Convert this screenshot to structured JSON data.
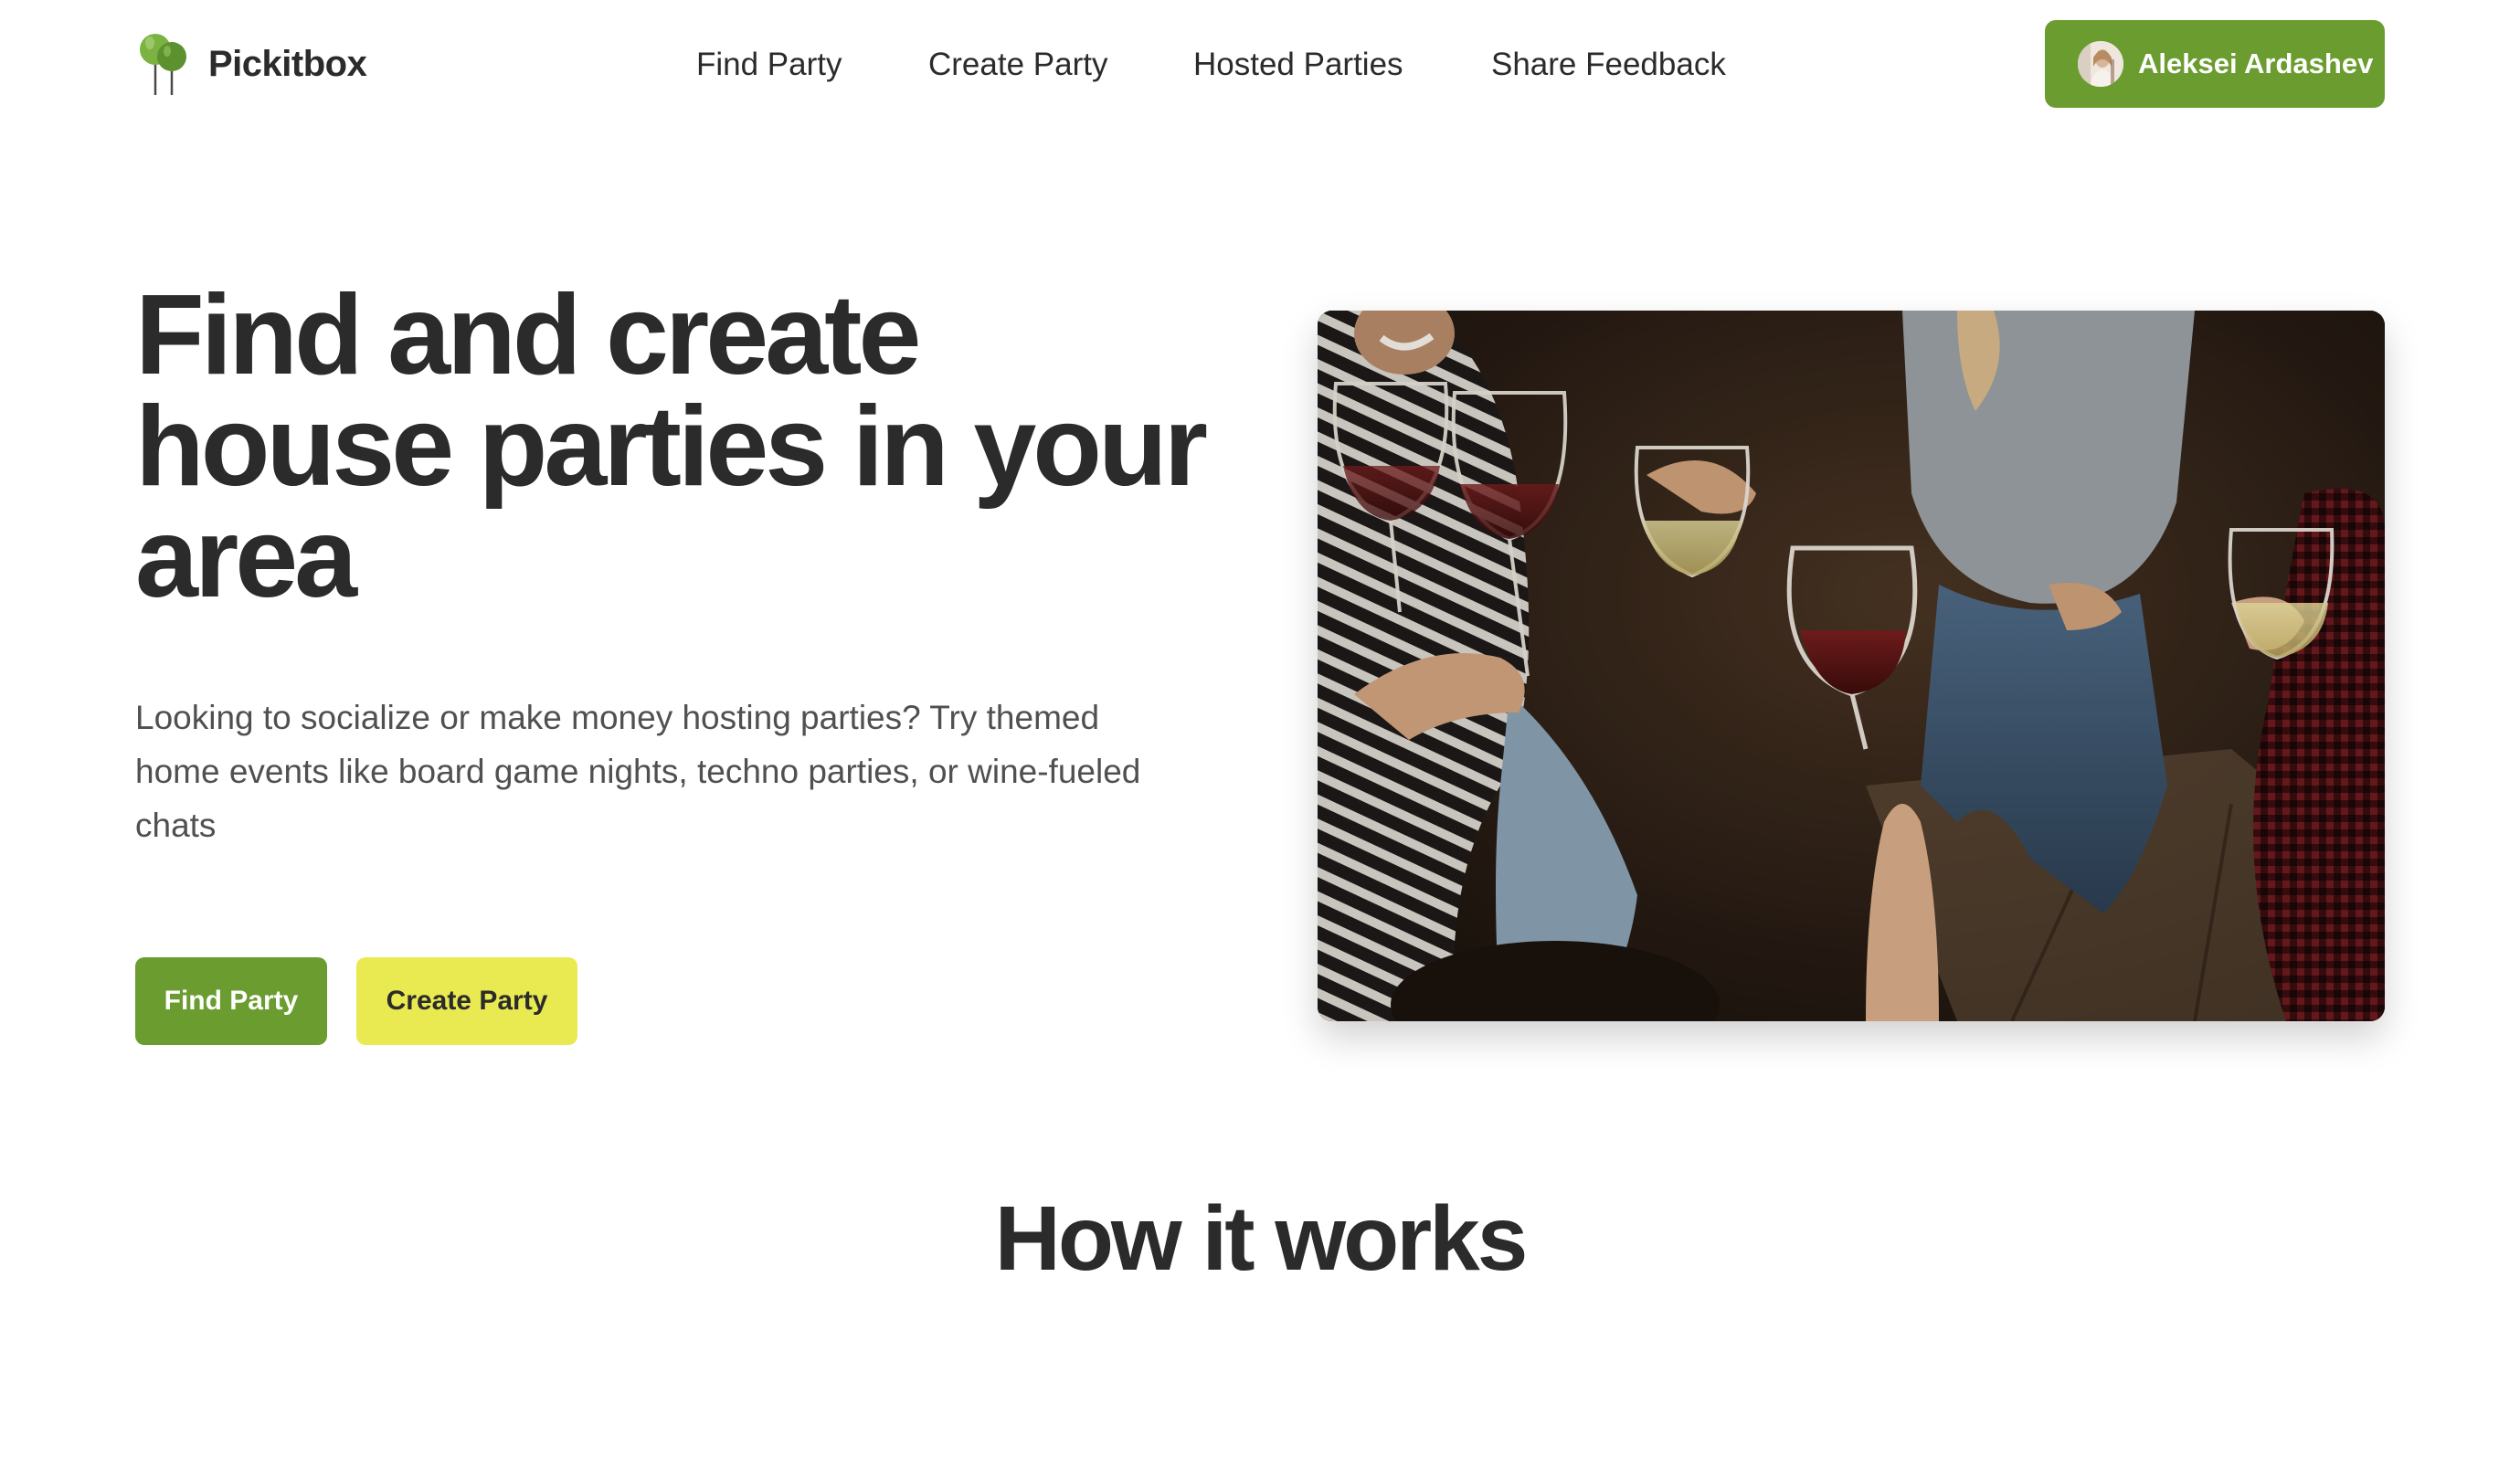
{
  "brand": {
    "name": "Pickitbox",
    "logo_icon": "balloons-icon",
    "accent": "#6a9c2f"
  },
  "nav": {
    "items": [
      {
        "label": "Find Party"
      },
      {
        "label": "Create Party"
      },
      {
        "label": "Hosted Parties"
      },
      {
        "label": "Share Feedback"
      }
    ]
  },
  "user": {
    "name": "Aleksei Ardashev",
    "button_color": "#6a9c2f"
  },
  "hero": {
    "title": "Find and create house parties in your area",
    "description": "Looking to socialize or make money hosting parties? Try themed home events like board game nights, techno parties, or wine-fueled chats",
    "primary_cta": "Find Party",
    "secondary_cta": "Create Party",
    "primary_color": "#6a9c2f",
    "secondary_color": "#e9e951"
  },
  "how_it_works": {
    "title": "How it works"
  }
}
